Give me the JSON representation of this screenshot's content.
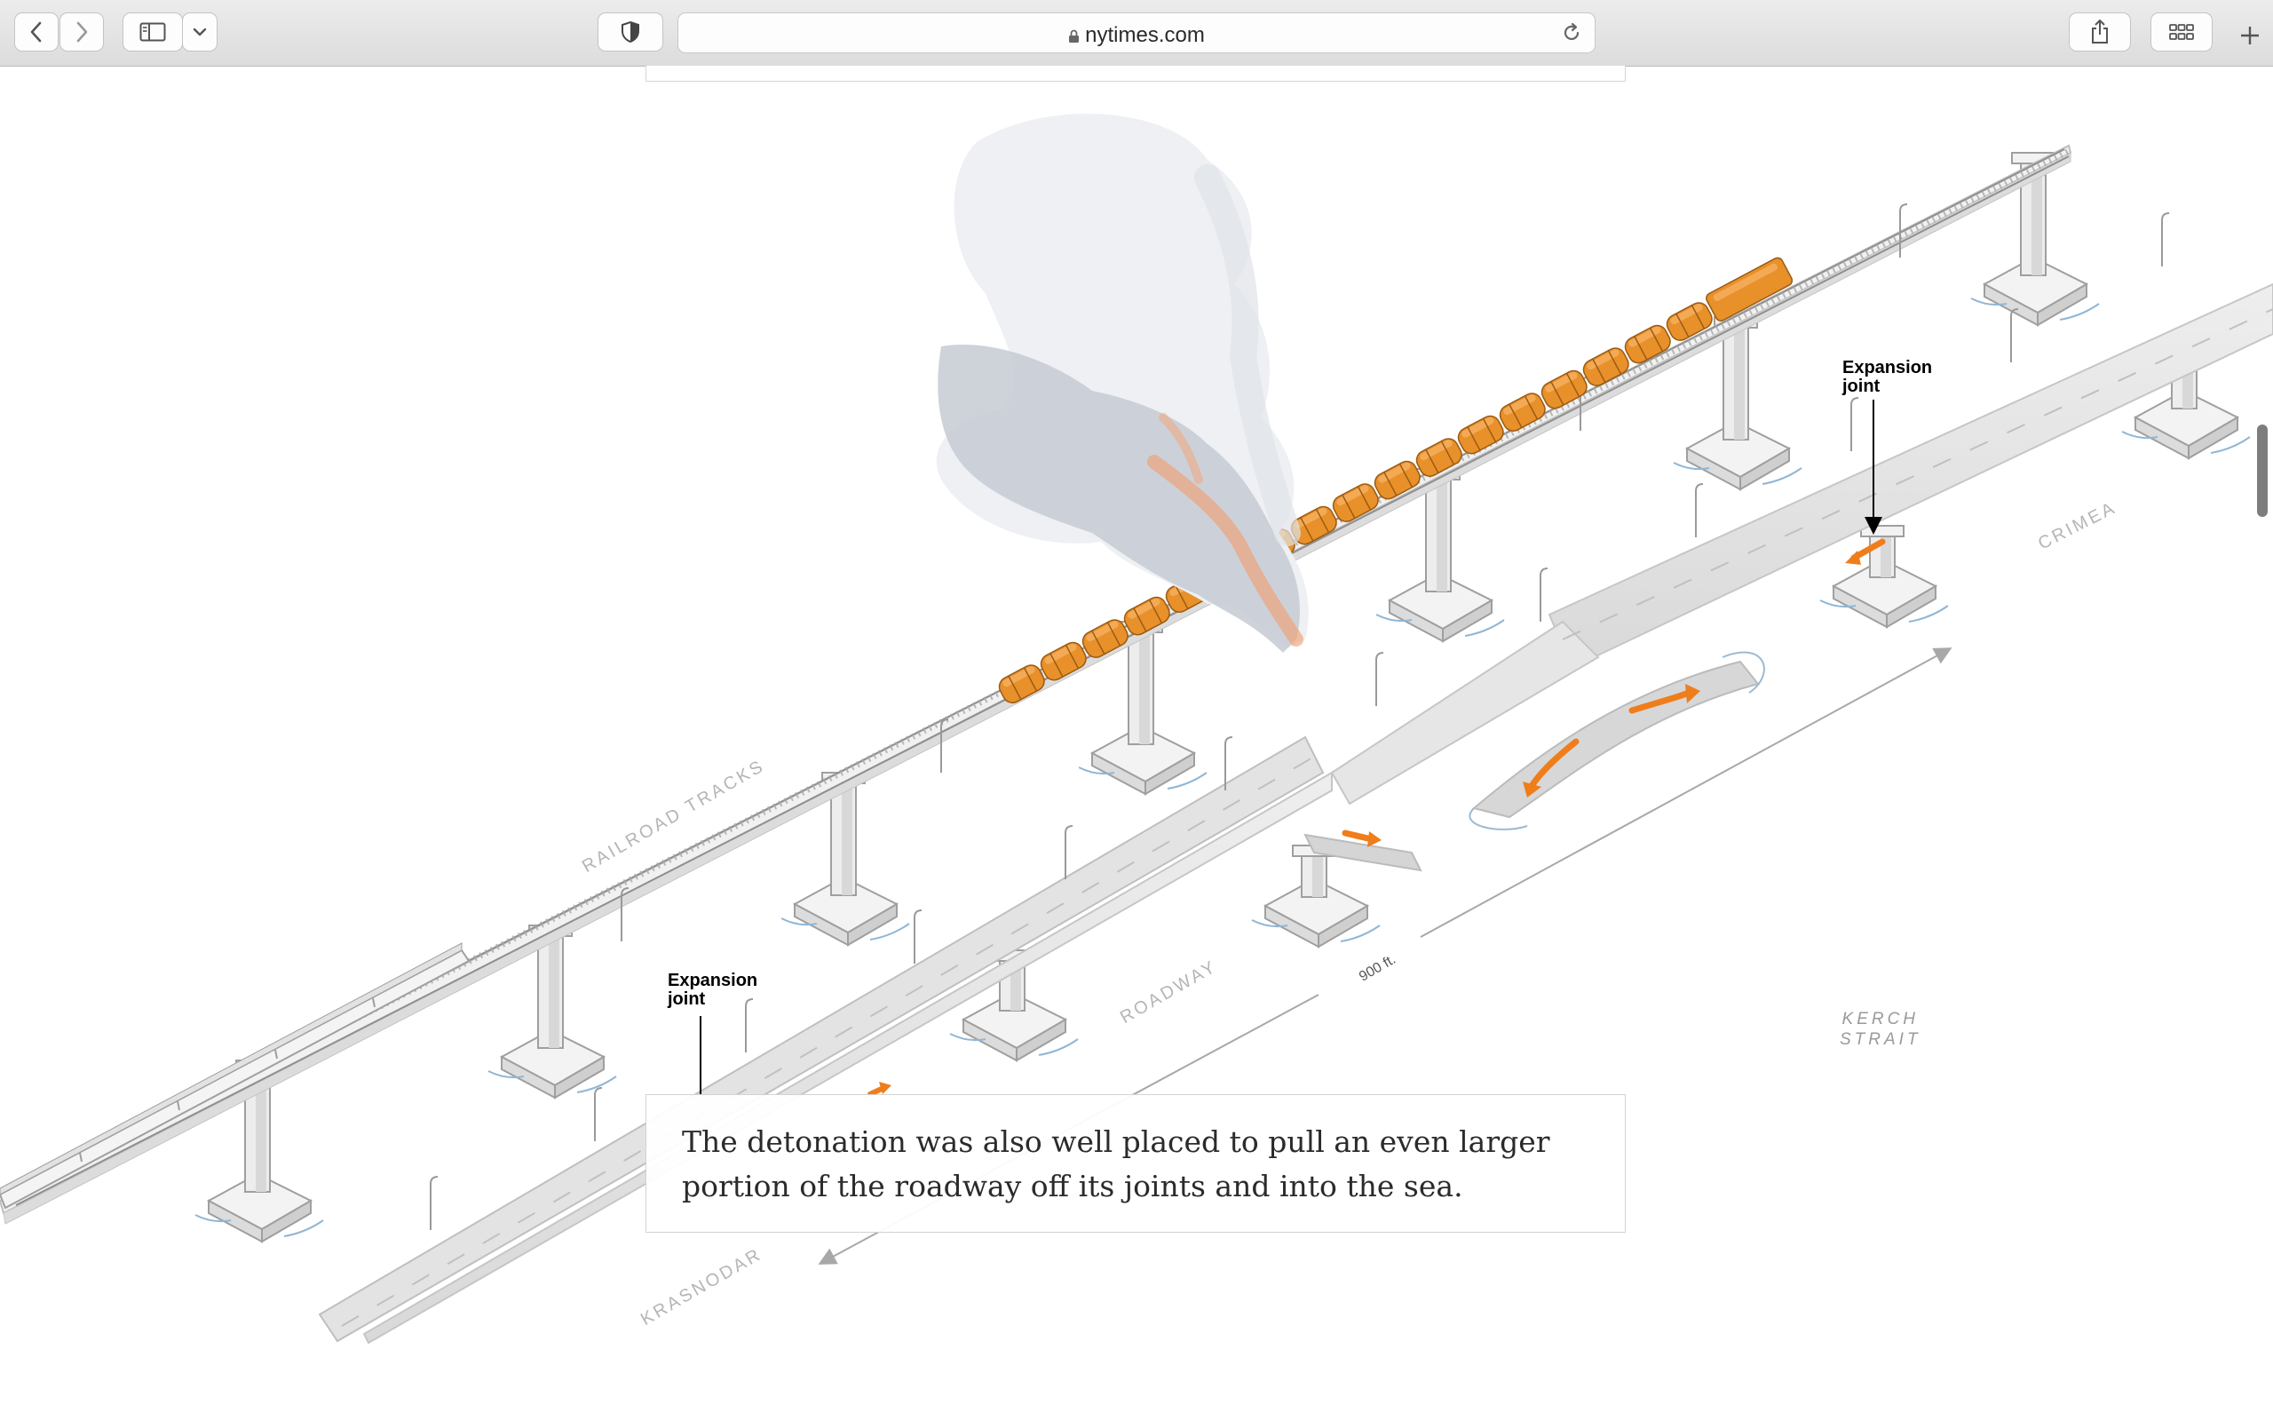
{
  "browser": {
    "url": "nytimes.com",
    "icons": {
      "back": "chevron-left-icon",
      "forward": "chevron-right-icon",
      "sidebar": "sidebar-icon",
      "sidebar_menu": "chevron-down-icon",
      "privacy": "shield-icon",
      "reader": "reader-lines-icon",
      "lock": "lock-icon",
      "reload": "reload-icon",
      "share": "share-icon",
      "tab_overview": "grid-icon",
      "new_tab": "plus-icon"
    }
  },
  "graphic": {
    "labels": {
      "railroad": "RAILROAD TRACKS",
      "roadway": "ROADWAY",
      "crimea": "CRIMEA",
      "krasnodar": "KRASNODAR",
      "strait_line1": "KERCH",
      "strait_line2": "STRAIT",
      "distance": "900 ft."
    },
    "annotations": [
      {
        "line1": "Expansion",
        "line2": "joint"
      },
      {
        "line1": "Expansion",
        "line2": "joint"
      }
    ],
    "colors": {
      "tanker": "#e8902a",
      "arrow": "#f07d1b",
      "smoke": "#c8ccd3",
      "bridge": "#dedede"
    }
  },
  "callout": {
    "text": "The detonation was also well placed to pull an even larger portion of the roadway off its joints and into the sea."
  }
}
